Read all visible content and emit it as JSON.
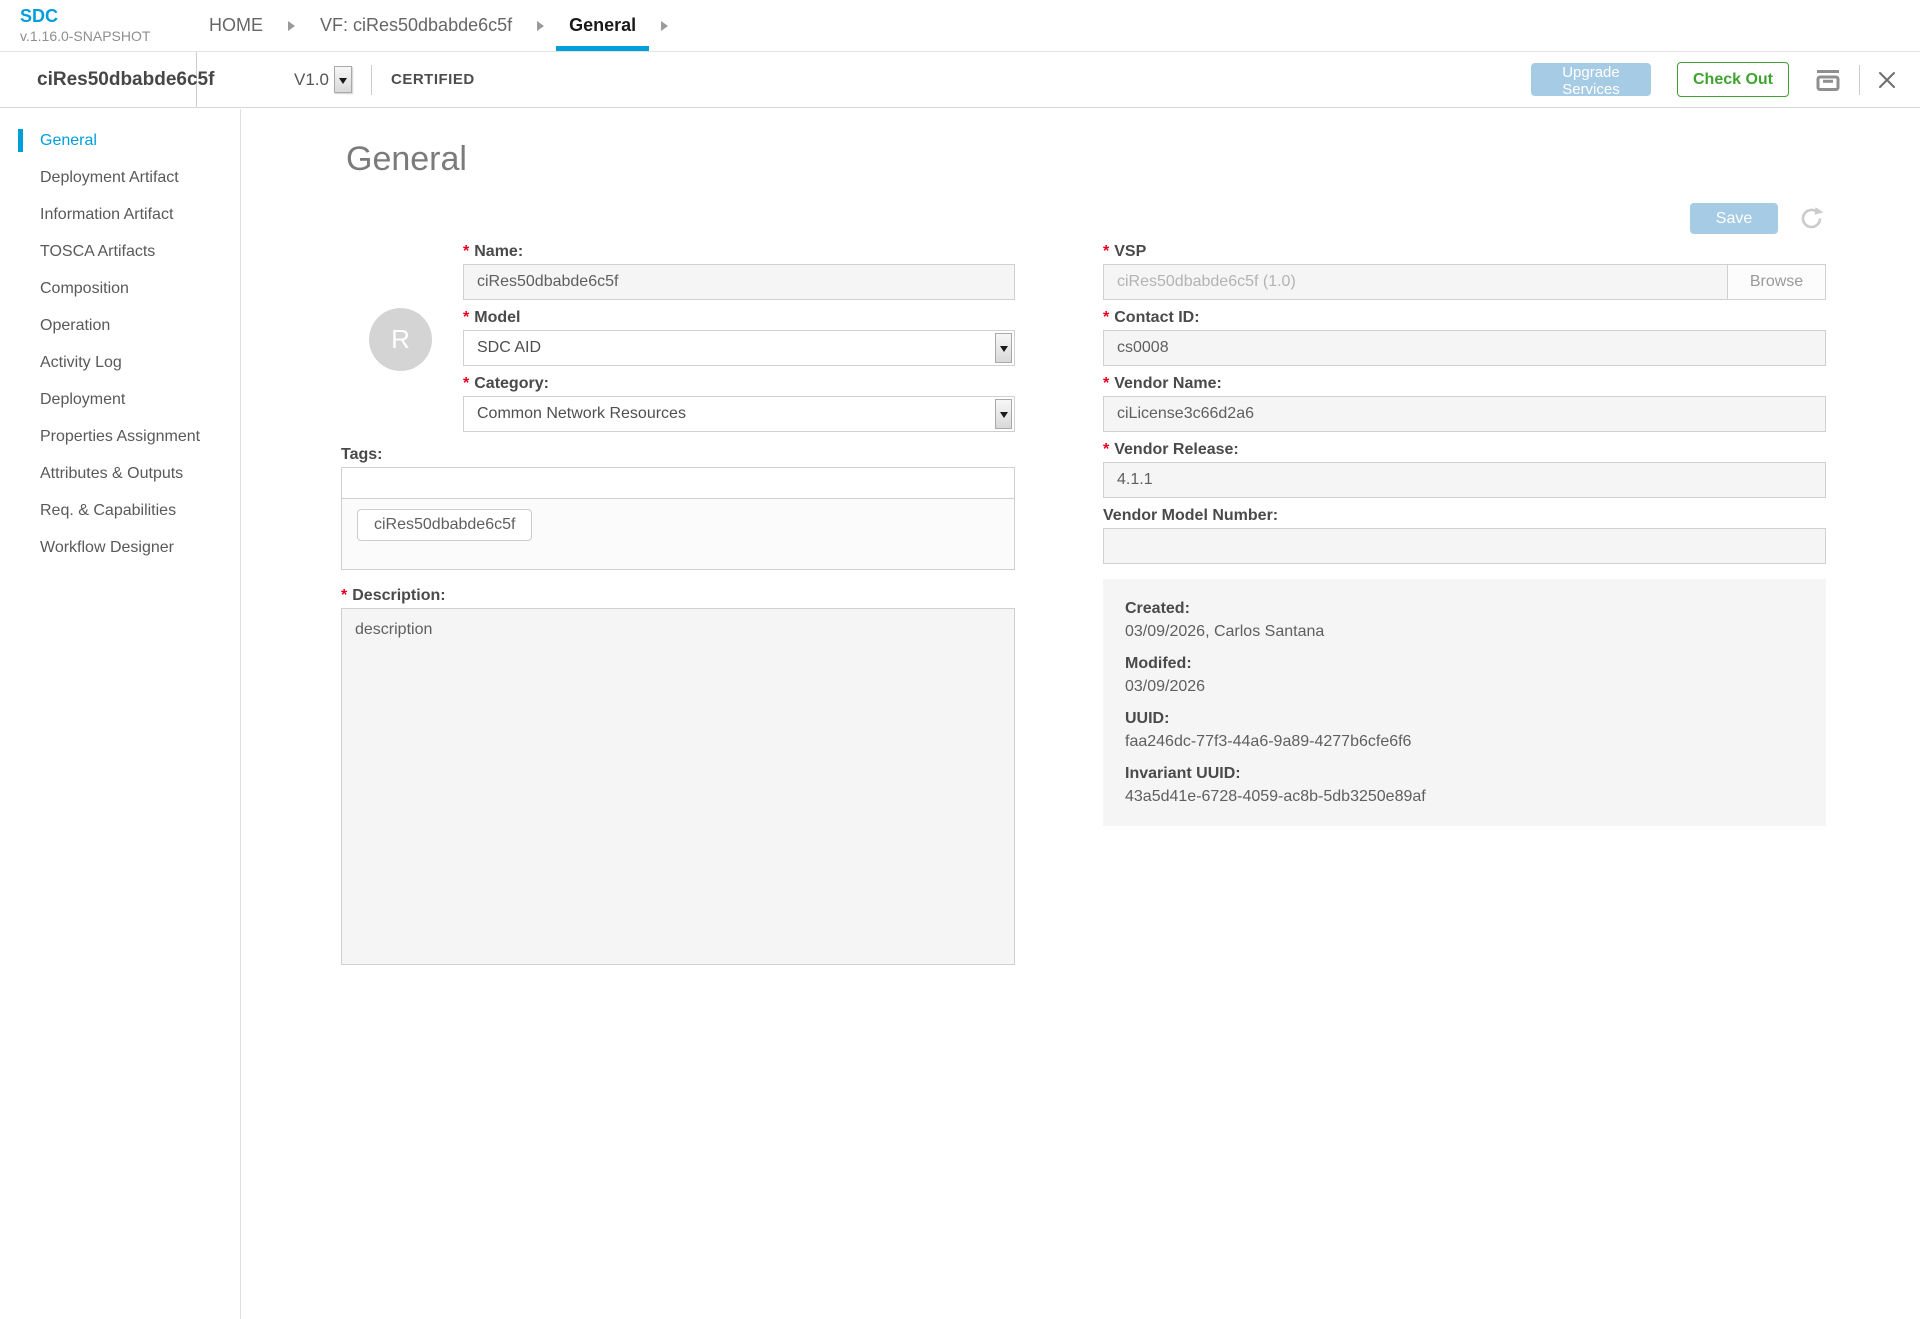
{
  "brand": {
    "name": "SDC",
    "version": "v.1.16.0-SNAPSHOT"
  },
  "breadcrumbs": [
    {
      "label": "HOME"
    },
    {
      "label": "VF: ciRes50dbabde6c5f"
    },
    {
      "label": "General",
      "active": true
    }
  ],
  "toolbar": {
    "entity_title": "ciRes50dbabde6c5f",
    "version": "V1.0",
    "status": "CERTIFIED",
    "upgrade_services_label": "Upgrade Services",
    "check_out_label": "Check Out"
  },
  "sidebar": {
    "items": [
      {
        "label": "General",
        "active": true
      },
      {
        "label": "Deployment Artifact"
      },
      {
        "label": "Information Artifact"
      },
      {
        "label": "TOSCA Artifacts"
      },
      {
        "label": "Composition"
      },
      {
        "label": "Operation"
      },
      {
        "label": "Activity Log"
      },
      {
        "label": "Deployment"
      },
      {
        "label": "Properties Assignment"
      },
      {
        "label": "Attributes & Outputs"
      },
      {
        "label": "Req. & Capabilities"
      },
      {
        "label": "Workflow Designer"
      }
    ]
  },
  "page": {
    "title": "General",
    "save_label": "Save",
    "required_marker": "*",
    "avatar_letter": "R",
    "fields": {
      "name": {
        "label": "Name:",
        "required": true,
        "value": "ciRes50dbabde6c5f"
      },
      "model": {
        "label": "Model",
        "required": true,
        "value": "SDC AID"
      },
      "category": {
        "label": "Category:",
        "required": true,
        "value": "Common Network Resources"
      },
      "tags": {
        "label": "Tags:",
        "input_value": "",
        "chips": [
          "ciRes50dbabde6c5f"
        ]
      },
      "description": {
        "label": "Description:",
        "required": true,
        "value": "description"
      },
      "vsp": {
        "label": "VSP",
        "required": true,
        "value": "ciRes50dbabde6c5f (1.0)",
        "browse_label": "Browse"
      },
      "contact_id": {
        "label": "Contact ID:",
        "required": true,
        "value": "cs0008"
      },
      "vendor_name": {
        "label": "Vendor Name:",
        "required": true,
        "value": "ciLicense3c66d2a6"
      },
      "vendor_release": {
        "label": "Vendor Release:",
        "required": true,
        "value": "4.1.1"
      },
      "vendor_model_number": {
        "label": "Vendor Model Number:",
        "required": false,
        "value": ""
      }
    },
    "meta": [
      {
        "label": "Created:",
        "value": "03/09/2026, Carlos Santana"
      },
      {
        "label": "Modifed:",
        "value": "03/09/2026"
      },
      {
        "label": "UUID:",
        "value": "faa246dc-77f3-44a6-9a89-4277b6cfe6f6"
      },
      {
        "label": "Invariant UUID:",
        "value": "43a5d41e-6728-4059-ac8b-5db3250e89af"
      }
    ]
  },
  "colors": {
    "accent_blue": "#009fdb",
    "button_blue": "#a6cbe5",
    "green": "#3fa32f",
    "required_red": "#e8001f",
    "label_dark": "#4a4a4a",
    "text_gray": "#5f5f5f"
  }
}
